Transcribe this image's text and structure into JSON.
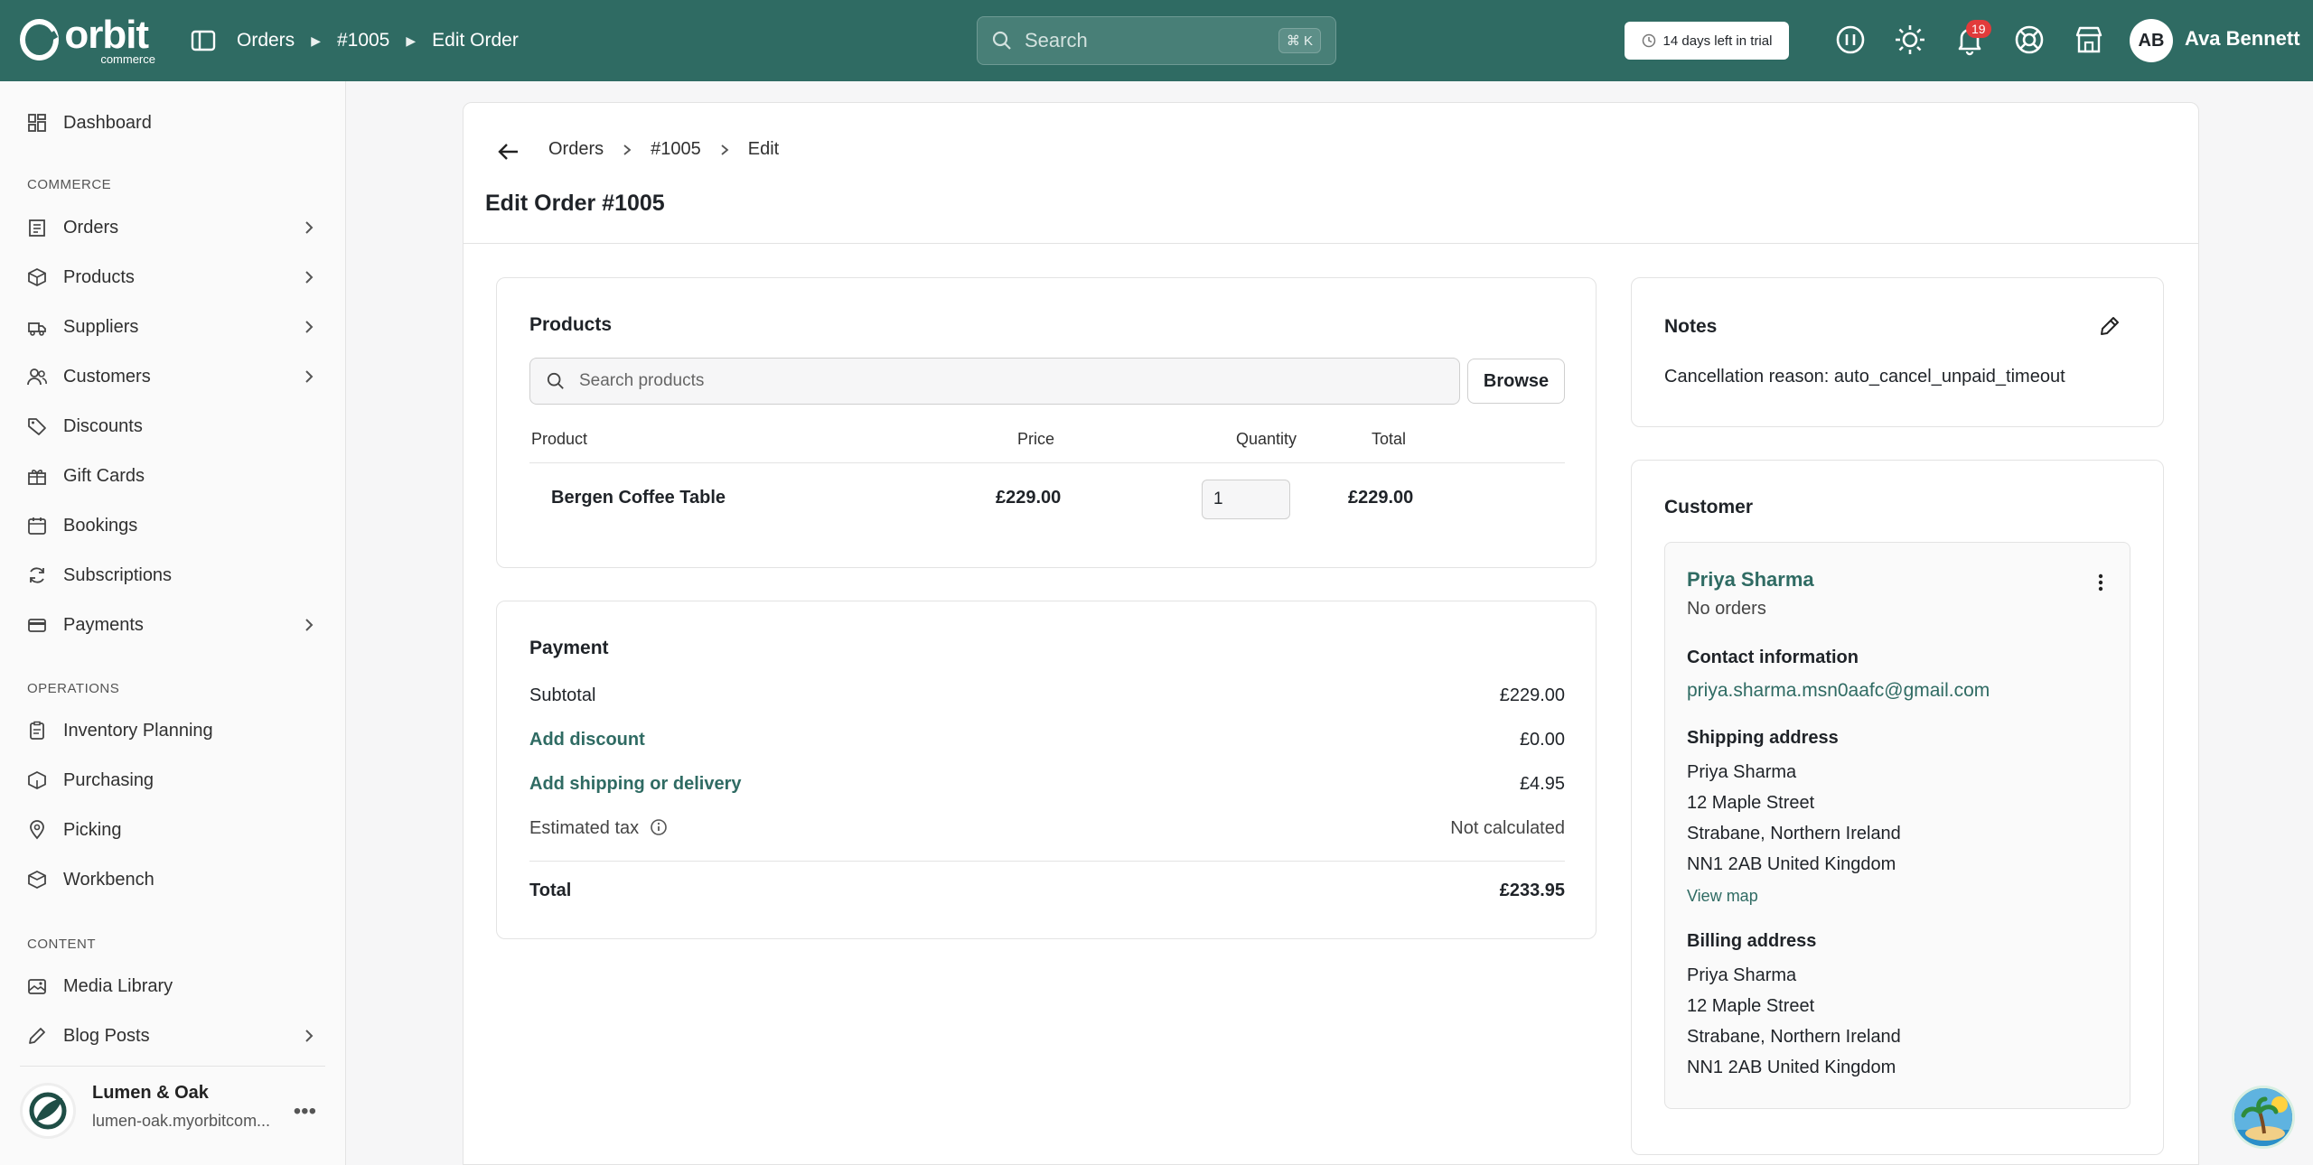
{
  "topbar": {
    "brand": "orbit",
    "brand_sub": "commerce",
    "breadcrumb": [
      "Orders",
      "#1005",
      "Edit Order"
    ],
    "search_placeholder": "Search",
    "search_shortcut": "⌘ K",
    "trial_text": "14 days left in trial",
    "notification_count": "19",
    "user_initials": "AB",
    "user_name": "Ava Bennett",
    "accent_color": "#2f6b63"
  },
  "sidebar": {
    "items_top": [
      {
        "label": "Dashboard",
        "icon": "dashboard-icon"
      }
    ],
    "sections": [
      {
        "label": "COMMERCE",
        "items": [
          {
            "label": "Orders",
            "icon": "orders-icon",
            "expandable": true
          },
          {
            "label": "Products",
            "icon": "products-icon",
            "expandable": true
          },
          {
            "label": "Suppliers",
            "icon": "suppliers-icon",
            "expandable": true
          },
          {
            "label": "Customers",
            "icon": "customers-icon",
            "expandable": true
          },
          {
            "label": "Discounts",
            "icon": "discount-tag-icon",
            "expandable": false
          },
          {
            "label": "Gift Cards",
            "icon": "gift-icon",
            "expandable": false
          },
          {
            "label": "Bookings",
            "icon": "calendar-icon",
            "expandable": false
          },
          {
            "label": "Subscriptions",
            "icon": "refresh-icon",
            "expandable": false
          },
          {
            "label": "Payments",
            "icon": "card-icon",
            "expandable": true
          }
        ]
      },
      {
        "label": "OPERATIONS",
        "items": [
          {
            "label": "Inventory Planning",
            "icon": "clipboard-icon"
          },
          {
            "label": "Purchasing",
            "icon": "purchase-box-icon"
          },
          {
            "label": "Picking",
            "icon": "location-pin-icon"
          },
          {
            "label": "Workbench",
            "icon": "workbench-icon"
          }
        ]
      },
      {
        "label": "CONTENT",
        "items": [
          {
            "label": "Media Library",
            "icon": "image-icon"
          },
          {
            "label": "Blog Posts",
            "icon": "pen-icon",
            "expandable": true
          }
        ]
      }
    ],
    "store": {
      "name": "Lumen & Oak",
      "url": "lumen-oak.myorbitcom..."
    }
  },
  "main": {
    "breadcrumb": [
      "Orders",
      "#1005",
      "Edit"
    ],
    "title": "Edit Order #1005",
    "products": {
      "title": "Products",
      "search_placeholder": "Search products",
      "browse_label": "Browse",
      "columns": [
        "Product",
        "Price",
        "Quantity",
        "Total"
      ],
      "rows": [
        {
          "product": "Bergen Coffee Table",
          "price": "£229.00",
          "quantity": "1",
          "total": "£229.00"
        }
      ]
    },
    "payment": {
      "title": "Payment",
      "subtotal_label": "Subtotal",
      "subtotal_value": "£229.00",
      "discount_label": "Add discount",
      "discount_value": "£0.00",
      "shipping_label": "Add shipping or delivery",
      "shipping_value": "£4.95",
      "tax_label": "Estimated tax",
      "tax_value": "Not calculated",
      "total_label": "Total",
      "total_value": "£233.95"
    },
    "notes": {
      "title": "Notes",
      "text": "Cancellation reason: auto_cancel_unpaid_timeout"
    },
    "customer": {
      "title": "Customer",
      "name": "Priya Sharma",
      "orders": "No orders",
      "contact_label": "Contact information",
      "email": "priya.sharma.msn0aafc@gmail.com",
      "shipping_label": "Shipping address",
      "shipping_lines": [
        "Priya Sharma",
        "12 Maple Street",
        "Strabane, Northern Ireland",
        "NN1 2AB United Kingdom"
      ],
      "view_map": "View map",
      "billing_label": "Billing address",
      "billing_lines": [
        "Priya Sharma",
        "12 Maple Street",
        "Strabane, Northern Ireland",
        "NN1 2AB United Kingdom"
      ]
    }
  }
}
